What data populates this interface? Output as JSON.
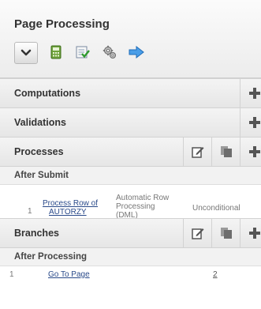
{
  "panel": {
    "title": "Page Processing",
    "toolbar": [
      {
        "name": "collapse",
        "icon": "chevron-down-icon"
      },
      {
        "name": "calculator",
        "icon": "calculator-icon"
      },
      {
        "name": "validate",
        "icon": "checklist-icon"
      },
      {
        "name": "process",
        "icon": "gears-icon"
      },
      {
        "name": "branch",
        "icon": "arrow-right-icon"
      }
    ]
  },
  "sections": {
    "computations": {
      "label": "Computations"
    },
    "validations": {
      "label": "Validations"
    },
    "processes": {
      "label": "Processes",
      "group": "After Submit"
    },
    "branches": {
      "label": "Branches",
      "group": "After Processing"
    }
  },
  "process_rows": [
    {
      "index": "1",
      "name_line1": "Process Row of",
      "name_line2": "AUTORZY",
      "type_line1": "Automatic Row",
      "type_line2": "Processing",
      "type_line3": "(DML)",
      "condition": "Unconditional"
    }
  ],
  "branch_rows": [
    {
      "index": "1",
      "name": "Go To Page",
      "target": "2"
    }
  ],
  "colors": {
    "accent_link": "#2a4a8a",
    "header_bg": "#f4f4f4"
  }
}
